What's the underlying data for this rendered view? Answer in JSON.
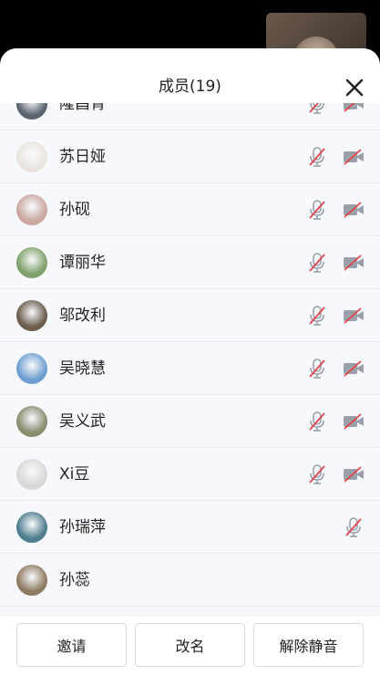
{
  "sheet": {
    "title": "成员(19)"
  },
  "members": [
    {
      "name": "隆昌青",
      "mic": "muted",
      "cam": "off",
      "avatar_color": "#5a6470"
    },
    {
      "name": "苏日娅",
      "mic": "muted",
      "cam": "off",
      "avatar_color": "#e9e4df"
    },
    {
      "name": "孙砚",
      "mic": "muted",
      "cam": "off",
      "avatar_color": "#c9a7a0"
    },
    {
      "name": "谭丽华",
      "mic": "muted",
      "cam": "off",
      "avatar_color": "#7fa06b"
    },
    {
      "name": "邬改利",
      "mic": "muted",
      "cam": "off",
      "avatar_color": "#6b5c4d"
    },
    {
      "name": "吴晓慧",
      "mic": "muted",
      "cam": "off",
      "avatar_color": "#6e9ed0"
    },
    {
      "name": "吴义武",
      "mic": "muted",
      "cam": "off",
      "avatar_color": "#8a8c70"
    },
    {
      "name": "Xi豆",
      "mic": "muted",
      "cam": "off",
      "avatar_color": "#d8d8d8"
    },
    {
      "name": "孙瑞萍",
      "mic": "muted",
      "cam": "none",
      "avatar_color": "#4f7e8d"
    },
    {
      "name": "孙蕊",
      "mic": "none",
      "cam": "none",
      "avatar_color": "#8d7a62"
    }
  ],
  "footer": {
    "invite": "邀请",
    "rename": "改名",
    "unmute_all": "解除静音"
  },
  "colors": {
    "muted_red": "#e0454b",
    "icon_gray": "#9aa0aa"
  }
}
